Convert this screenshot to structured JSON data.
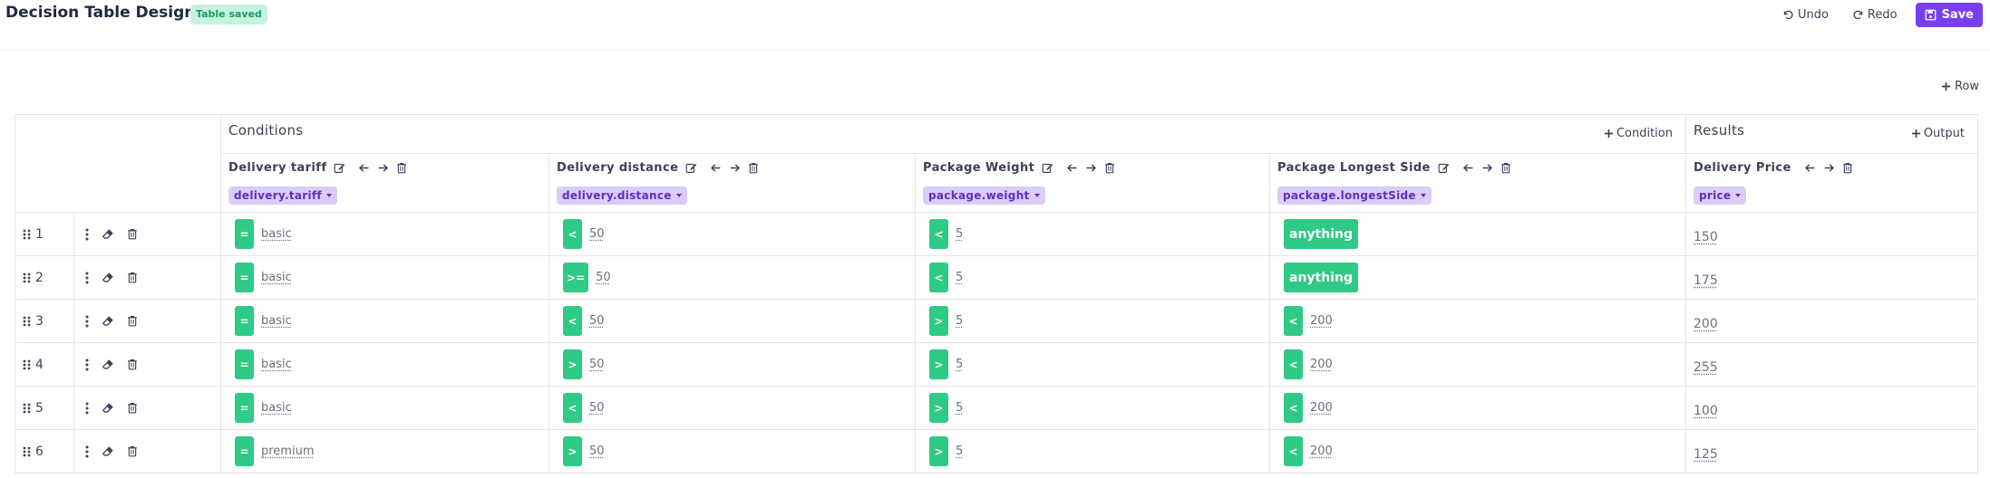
{
  "header": {
    "title": "Decision Table Designer",
    "badge": "Table saved",
    "undo": "Undo",
    "redo": "Redo",
    "save": "Save"
  },
  "add_row_label": "Row",
  "conditions": {
    "title": "Conditions",
    "add_label": "Condition",
    "columns": [
      {
        "label": "Delivery tariff",
        "field": "delivery.tariff"
      },
      {
        "label": "Delivery distance",
        "field": "delivery.distance"
      },
      {
        "label": "Package Weight",
        "field": "package.weight"
      },
      {
        "label": "Package Longest Side",
        "field": "package.longestSide"
      }
    ]
  },
  "results": {
    "title": "Results",
    "add_label": "Output",
    "columns": [
      {
        "label": "Delivery Price",
        "field": "price"
      }
    ]
  },
  "rows": [
    {
      "n": "1",
      "c": [
        {
          "op": "=",
          "val": "basic"
        },
        {
          "op": "<",
          "val": "50"
        },
        {
          "op": "<",
          "val": "5"
        },
        {
          "any": "anything"
        }
      ],
      "r": "150"
    },
    {
      "n": "2",
      "c": [
        {
          "op": "=",
          "val": "basic"
        },
        {
          "op": ">=",
          "val": "50"
        },
        {
          "op": "<",
          "val": "5"
        },
        {
          "any": "anything"
        }
      ],
      "r": "175"
    },
    {
      "n": "3",
      "c": [
        {
          "op": "=",
          "val": "basic"
        },
        {
          "op": "<",
          "val": "50"
        },
        {
          "op": ">",
          "val": "5"
        },
        {
          "op": "<",
          "val": "200"
        }
      ],
      "r": "200"
    },
    {
      "n": "4",
      "c": [
        {
          "op": "=",
          "val": "basic"
        },
        {
          "op": ">",
          "val": "50"
        },
        {
          "op": ">",
          "val": "5"
        },
        {
          "op": "<",
          "val": "200"
        }
      ],
      "r": "255"
    },
    {
      "n": "5",
      "c": [
        {
          "op": "=",
          "val": "basic"
        },
        {
          "op": "<",
          "val": "50"
        },
        {
          "op": ">",
          "val": "5"
        },
        {
          "op": "<",
          "val": "200"
        }
      ],
      "r": "100"
    },
    {
      "n": "6",
      "c": [
        {
          "op": "=",
          "val": "premium"
        },
        {
          "op": ">",
          "val": "50"
        },
        {
          "op": ">",
          "val": "5"
        },
        {
          "op": "<",
          "val": "200"
        }
      ],
      "r": "125"
    }
  ],
  "colors": {
    "accent": "#7a3df0",
    "operator": "#2fca86",
    "field_pill": "#d9cdf8",
    "badge": "#c6f3dd"
  }
}
